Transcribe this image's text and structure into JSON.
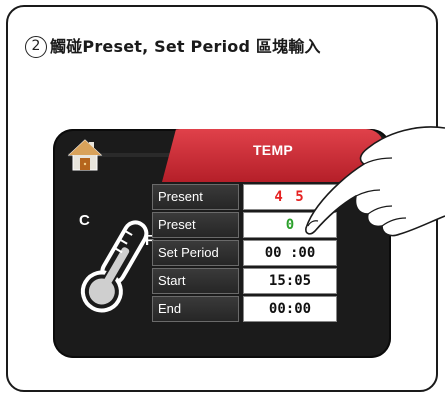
{
  "instruction": {
    "step": "2",
    "text": "觸碰Preset, Set Period 區塊輸入"
  },
  "tab": {
    "label": "TEMP"
  },
  "thermometer": {
    "c_label": "C",
    "f_label": "F"
  },
  "rows": [
    {
      "label": "Present",
      "value": "4 5"
    },
    {
      "label": "Preset",
      "value": "0"
    },
    {
      "label": "Set Period",
      "value": "00 :00"
    },
    {
      "label": "Start",
      "value": "15:05"
    },
    {
      "label": "End",
      "value": "00:00"
    }
  ],
  "colors": {
    "tab_red": "#c8262f",
    "present_value": "#e52222",
    "preset_value": "#2ca02c",
    "device_body": "#1b1b1b"
  }
}
